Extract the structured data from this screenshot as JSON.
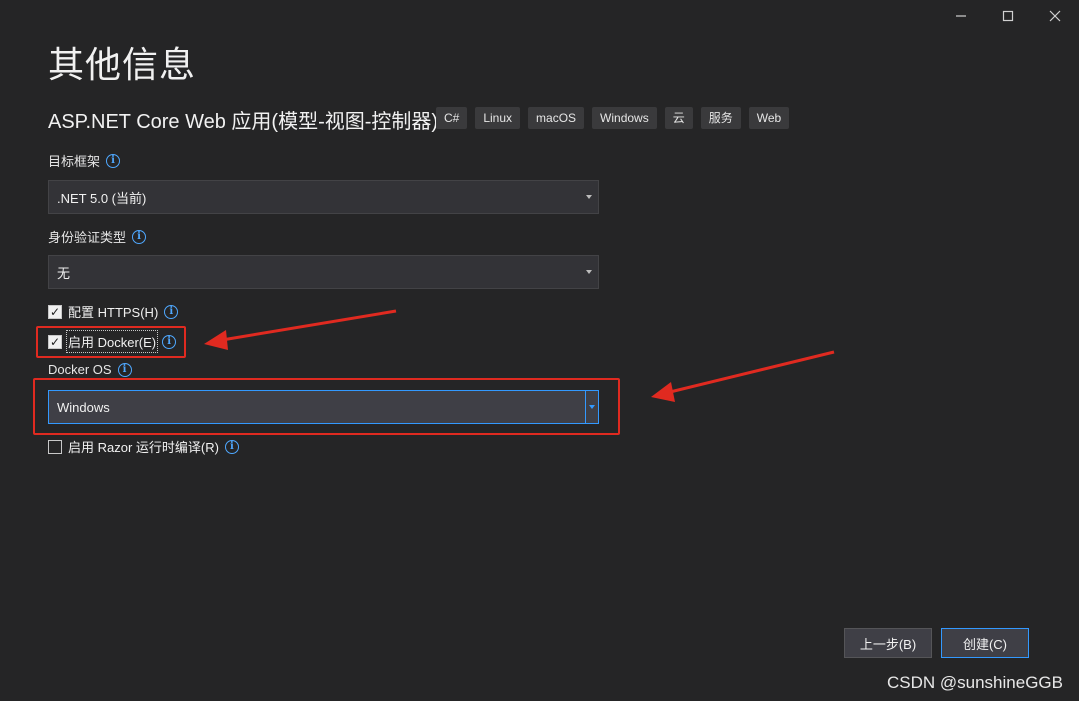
{
  "window_controls": {
    "minimize_icon": "minimize-icon",
    "maximize_icon": "maximize-icon",
    "close_icon": "close-icon"
  },
  "page_title": "其他信息",
  "subtitle": "ASP.NET Core Web 应用(模型-视图-控制器)",
  "tags": [
    "C#",
    "Linux",
    "macOS",
    "Windows",
    "云",
    "服务",
    "Web"
  ],
  "target_framework": {
    "label": "目标框架",
    "value": ".NET 5.0 (当前)"
  },
  "auth_type": {
    "label": "身份验证类型",
    "value": "无"
  },
  "https": {
    "label": "配置 HTTPS(H)",
    "checked": true
  },
  "docker": {
    "label": "启用 Docker(E)",
    "checked": true
  },
  "docker_os": {
    "label": "Docker OS",
    "value": "Windows"
  },
  "razor": {
    "label": "启用 Razor 运行时编译(R)",
    "checked": false
  },
  "buttons": {
    "back": "上一步(B)",
    "create": "创建(C)"
  },
  "annotation_color": "#e02a20",
  "watermark": "CSDN @sunshineGGB"
}
